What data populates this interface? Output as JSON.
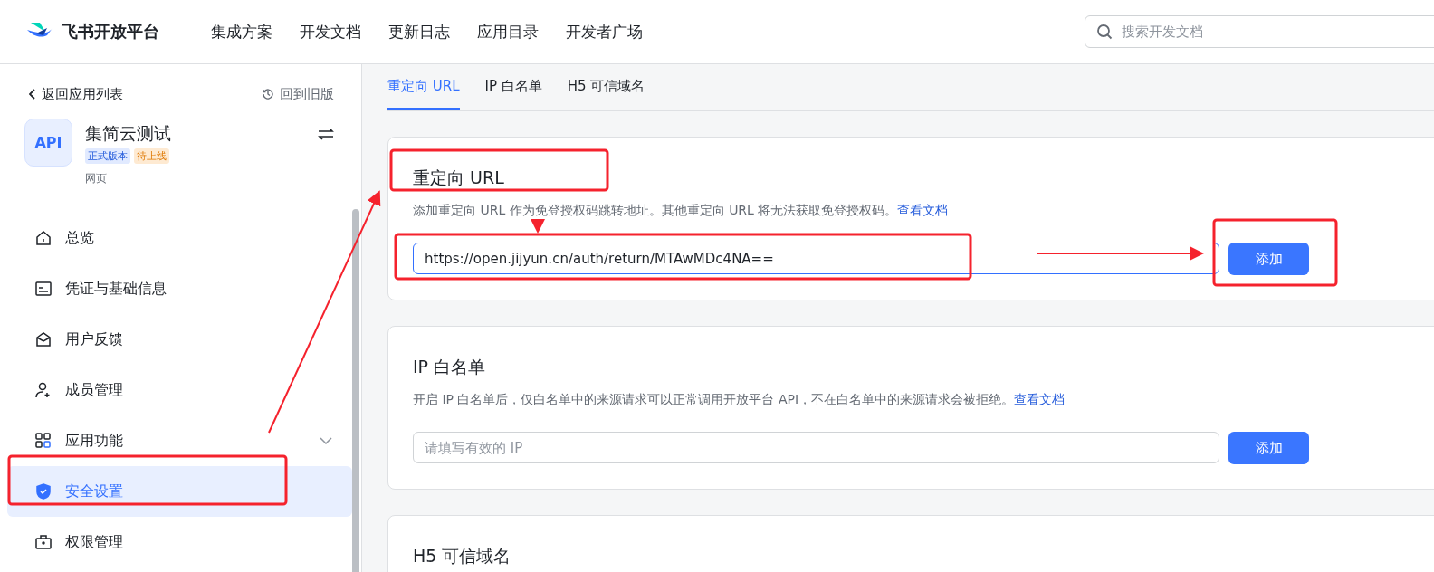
{
  "header": {
    "brand": "飞书开放平台",
    "nav": [
      "集成方案",
      "开发文档",
      "更新日志",
      "应用目录",
      "开发者广场"
    ],
    "search": {
      "placeholder": "搜索开发文档"
    }
  },
  "sidebar": {
    "back": "返回应用列表",
    "old_version": "回到旧版",
    "app": {
      "icon_text": "API",
      "name": "集简云测试",
      "tags": [
        {
          "label": "正式版本",
          "kind": "release"
        },
        {
          "label": "待上线",
          "kind": "pending"
        }
      ],
      "type": "网页"
    },
    "items": [
      {
        "label": "总览",
        "selected": false
      },
      {
        "label": "凭证与基础信息",
        "selected": false
      },
      {
        "label": "用户反馈",
        "selected": false
      },
      {
        "label": "成员管理",
        "selected": false
      },
      {
        "label": "应用功能",
        "selected": false,
        "expanded": false
      },
      {
        "label": "安全设置",
        "selected": true
      },
      {
        "label": "权限管理",
        "selected": false
      }
    ]
  },
  "tabs": [
    {
      "label": "重定向 URL",
      "selected": true
    },
    {
      "label": "IP 白名单",
      "selected": false
    },
    {
      "label": "H5 可信域名",
      "selected": false
    }
  ],
  "sections": [
    {
      "title": "重定向 URL",
      "description": "添加重定向 URL 作为免登授权码跳转地址。其他重定向 URL 将无法获取免登授权码。",
      "link": "查看文档",
      "input": {
        "value": "https://open.jijyun.cn/auth/return/MTAwMDc4NA=="
      },
      "button": "添加"
    },
    {
      "title": "IP 白名单",
      "description": "开启 IP 白名单后，仅白名单中的来源请求可以正常调用开放平台 API，不在白名单中的来源请求会被拒绝。",
      "link": "查看文档",
      "input": {
        "placeholder": "请填写有效的 IP"
      },
      "button": "添加"
    },
    {
      "title": "H5 可信域名"
    }
  ]
}
